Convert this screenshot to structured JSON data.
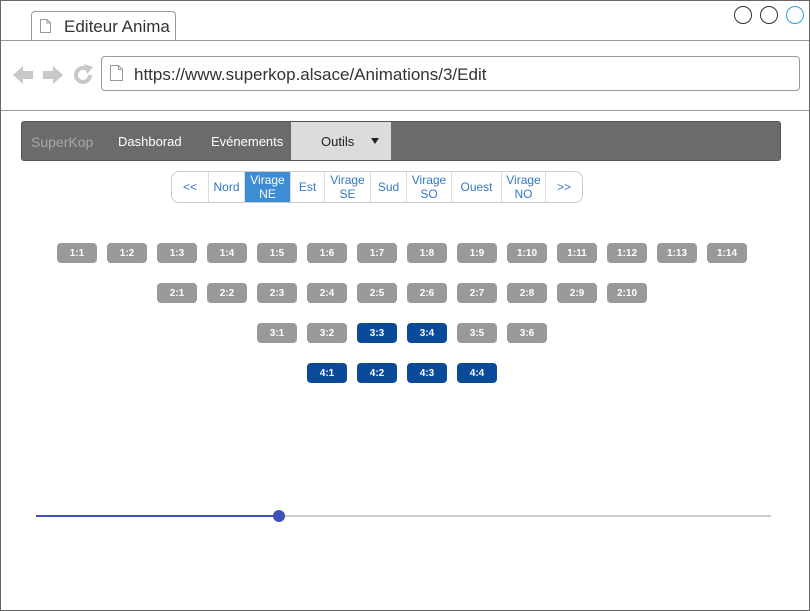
{
  "window": {
    "tab_title": "Editeur Anima",
    "url": "https://www.superkop.alsace/Animations/3/Edit",
    "icons": {
      "back": "arrow-left-icon",
      "forward": "arrow-right-icon",
      "reload": "reload-icon",
      "page": "document-icon"
    }
  },
  "navbar": {
    "brand": "SuperKop",
    "links": [
      "Dashborad",
      "Evénements"
    ],
    "dropdown": "Outils"
  },
  "pager": {
    "items": [
      {
        "label": "<<",
        "active": false
      },
      {
        "label": "Nord",
        "active": false
      },
      {
        "label": "Virage\nNE",
        "active": true
      },
      {
        "label": "Est",
        "active": false
      },
      {
        "label": "Virage\nSE",
        "active": false
      },
      {
        "label": "Sud",
        "active": false
      },
      {
        "label": "Virage\nSO",
        "active": false
      },
      {
        "label": "Ouest",
        "active": false
      },
      {
        "label": "Virage\nNO",
        "active": false
      },
      {
        "label": ">>",
        "active": false
      }
    ]
  },
  "seats": {
    "rows": [
      {
        "seats": [
          {
            "label": "1:1",
            "selected": false
          },
          {
            "label": "1:2",
            "selected": false
          },
          {
            "label": "1:3",
            "selected": false
          },
          {
            "label": "1:4",
            "selected": false
          },
          {
            "label": "1:5",
            "selected": false
          },
          {
            "label": "1:6",
            "selected": false
          },
          {
            "label": "1:7",
            "selected": false
          },
          {
            "label": "1:8",
            "selected": false
          },
          {
            "label": "1:9",
            "selected": false
          },
          {
            "label": "1:10",
            "selected": false
          },
          {
            "label": "1:11",
            "selected": false
          },
          {
            "label": "1:12",
            "selected": false
          },
          {
            "label": "1:13",
            "selected": false
          },
          {
            "label": "1:14",
            "selected": false
          }
        ]
      },
      {
        "seats": [
          {
            "label": "2:1",
            "selected": false
          },
          {
            "label": "2:2",
            "selected": false
          },
          {
            "label": "2:3",
            "selected": false
          },
          {
            "label": "2:4",
            "selected": false
          },
          {
            "label": "2:5",
            "selected": false
          },
          {
            "label": "2:6",
            "selected": false
          },
          {
            "label": "2:7",
            "selected": false
          },
          {
            "label": "2:8",
            "selected": false
          },
          {
            "label": "2:9",
            "selected": false
          },
          {
            "label": "2:10",
            "selected": false
          }
        ]
      },
      {
        "seats": [
          {
            "label": "3:1",
            "selected": false
          },
          {
            "label": "3:2",
            "selected": false
          },
          {
            "label": "3:3",
            "selected": true
          },
          {
            "label": "3:4",
            "selected": true
          },
          {
            "label": "3:5",
            "selected": false
          },
          {
            "label": "3:6",
            "selected": false
          }
        ]
      },
      {
        "seats": [
          {
            "label": "4:1",
            "selected": true
          },
          {
            "label": "4:2",
            "selected": true
          },
          {
            "label": "4:3",
            "selected": true
          },
          {
            "label": "4:4",
            "selected": true
          }
        ]
      }
    ]
  },
  "slider": {
    "value": 0.33
  },
  "colors": {
    "accent": "#3f51b5",
    "selected_seat": "#0b4a99",
    "seat": "#999999",
    "active_tab": "#3d8cd4"
  }
}
